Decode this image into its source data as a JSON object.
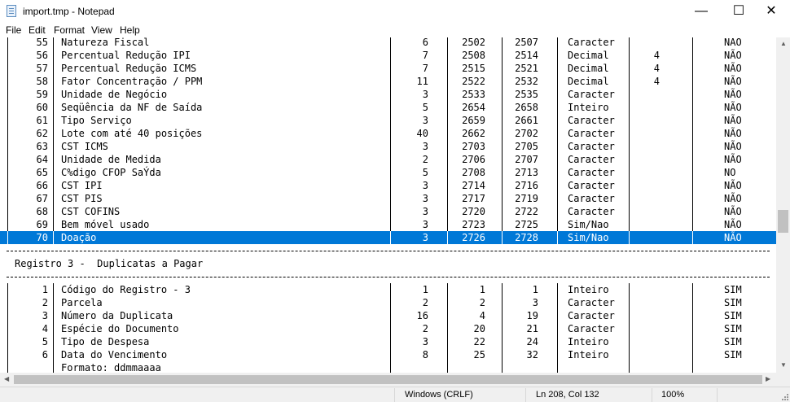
{
  "window": {
    "title": "import.tmp - Notepad",
    "minimize_glyph": "—",
    "maximize_glyph": "☐",
    "close_glyph": "✕"
  },
  "menu": [
    "File",
    "Edit",
    "Format",
    "View",
    "Help"
  ],
  "rows": [
    {
      "n": "55",
      "desc": "Natureza Fiscal",
      "size": "6",
      "start": "2502",
      "end": "2507",
      "type": "Caracter",
      "dec": "",
      "req": "NÃO"
    },
    {
      "n": "56",
      "desc": "Percentual Redução IPI",
      "size": "7",
      "start": "2508",
      "end": "2514",
      "type": "Decimal",
      "dec": "4",
      "req": "NÃO"
    },
    {
      "n": "57",
      "desc": "Percentual Redução ICMS",
      "size": "7",
      "start": "2515",
      "end": "2521",
      "type": "Decimal",
      "dec": "4",
      "req": "NÃO"
    },
    {
      "n": "58",
      "desc": "Fator Concentração / PPM",
      "size": "11",
      "start": "2522",
      "end": "2532",
      "type": "Decimal",
      "dec": "4",
      "req": "NÃO"
    },
    {
      "n": "59",
      "desc": "Unidade de Negócio",
      "size": "3",
      "start": "2533",
      "end": "2535",
      "type": "Caracter",
      "dec": "",
      "req": "NÃO"
    },
    {
      "n": "60",
      "desc": "Seqüência da NF de Saída",
      "size": "5",
      "start": "2654",
      "end": "2658",
      "type": "Inteiro",
      "dec": "",
      "req": "NÃO"
    },
    {
      "n": "61",
      "desc": "Tipo Serviço",
      "size": "3",
      "start": "2659",
      "end": "2661",
      "type": "Caracter",
      "dec": "",
      "req": "NÃO"
    },
    {
      "n": "62",
      "desc": "Lote com até 40 posições",
      "size": "40",
      "start": "2662",
      "end": "2702",
      "type": "Caracter",
      "dec": "",
      "req": "NÃO"
    },
    {
      "n": "63",
      "desc": "CST ICMS",
      "size": "3",
      "start": "2703",
      "end": "2705",
      "type": "Caracter",
      "dec": "",
      "req": "NÃO"
    },
    {
      "n": "64",
      "desc": "Unidade de Medida",
      "size": "2",
      "start": "2706",
      "end": "2707",
      "type": "Caracter",
      "dec": "",
      "req": "NÃO"
    },
    {
      "n": "65",
      "desc": "C%digo CFOP SaÝda",
      "size": "5",
      "start": "2708",
      "end": "2713",
      "type": "Caracter",
      "dec": "",
      "req": "NO"
    },
    {
      "n": "66",
      "desc": "CST IPI",
      "size": "3",
      "start": "2714",
      "end": "2716",
      "type": "Caracter",
      "dec": "",
      "req": "NÃO"
    },
    {
      "n": "67",
      "desc": "CST PIS",
      "size": "3",
      "start": "2717",
      "end": "2719",
      "type": "Caracter",
      "dec": "",
      "req": "NÃO"
    },
    {
      "n": "68",
      "desc": "CST COFINS",
      "size": "3",
      "start": "2720",
      "end": "2722",
      "type": "Caracter",
      "dec": "",
      "req": "NÃO"
    },
    {
      "n": "69",
      "desc": "Bem móvel usado",
      "size": "3",
      "start": "2723",
      "end": "2725",
      "type": "Sim/Nao",
      "dec": "",
      "req": "NÃO"
    },
    {
      "n": "70",
      "desc": "Doação",
      "size": "3",
      "start": "2726",
      "end": "2728",
      "type": "Sim/Nao",
      "dec": "",
      "req": "NÃO",
      "selected": true
    }
  ],
  "section_title": "Registro 3 -  Duplicatas a Pagar",
  "rows2": [
    {
      "n": "1",
      "desc": "Código do Registro - 3",
      "size": "1",
      "start": "1",
      "end": "1",
      "type": "Inteiro",
      "dec": "",
      "req": "SIM"
    },
    {
      "n": "2",
      "desc": "Parcela",
      "size": "2",
      "start": "2",
      "end": "3",
      "type": "Caracter",
      "dec": "",
      "req": "SIM"
    },
    {
      "n": "3",
      "desc": "Número da Duplicata",
      "size": "16",
      "start": "4",
      "end": "19",
      "type": "Caracter",
      "dec": "",
      "req": "SIM"
    },
    {
      "n": "4",
      "desc": "Espécie do Documento",
      "size": "2",
      "start": "20",
      "end": "21",
      "type": "Caracter",
      "dec": "",
      "req": "SIM"
    },
    {
      "n": "5",
      "desc": "Tipo de Despesa",
      "size": "3",
      "start": "22",
      "end": "24",
      "type": "Inteiro",
      "dec": "",
      "req": "SIM"
    },
    {
      "n": "6",
      "desc": "Data do Vencimento",
      "size": "8",
      "start": "25",
      "end": "32",
      "type": "Inteiro",
      "dec": "",
      "req": "SIM"
    }
  ],
  "partial_line": "Formato: ddmmaaaa",
  "status": {
    "line_ending": "Windows (CRLF)",
    "position": "Ln 208, Col 132",
    "zoom": "100%"
  }
}
